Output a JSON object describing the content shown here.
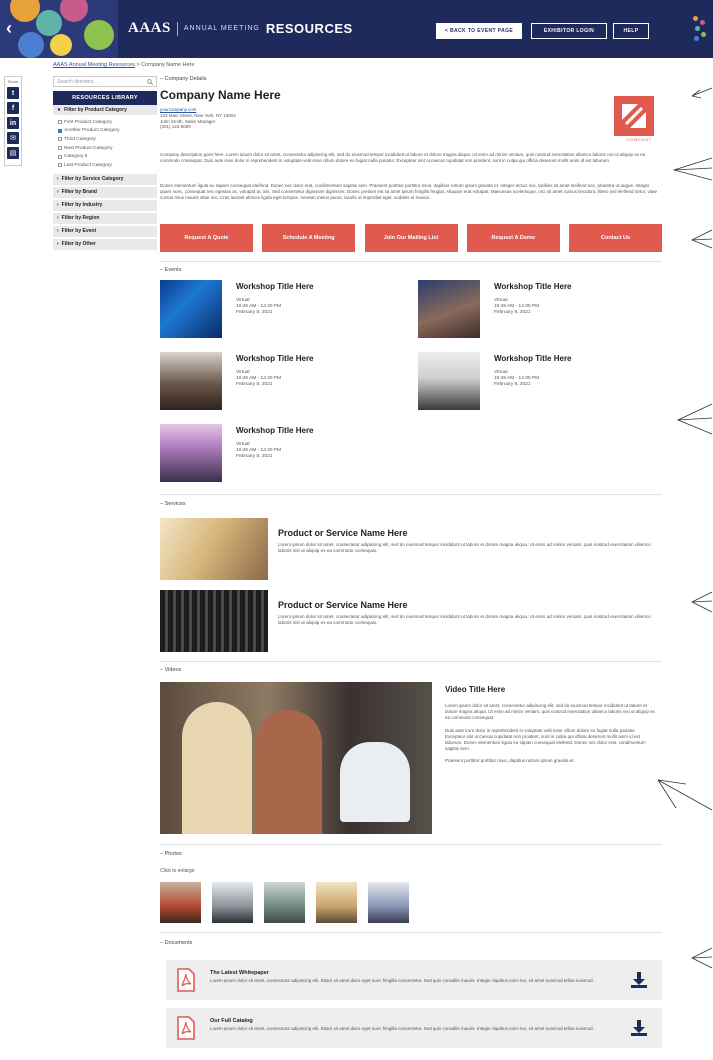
{
  "header": {
    "brand": "AAAS",
    "subtitle": "ANNUAL MEETING",
    "title": "RESOURCES",
    "buttons": {
      "back": "< BACK TO EVENT PAGE",
      "exhibitor": "EXHIBITOR LOGIN",
      "help": "HELP"
    }
  },
  "breadcrumb": {
    "link": "AAAS Annual Meeting Resources",
    "separator": " > ",
    "current": "Company Name Here"
  },
  "share": {
    "label": "Share"
  },
  "sidebar": {
    "search_placeholder": "Search directory...",
    "library_title": "RESOURCES LIBRARY",
    "open_filter": "Filter by Product Category",
    "categories": [
      {
        "label": "First Product Category",
        "checked": false
      },
      {
        "label": "Another Product Category",
        "checked": true
      },
      {
        "label": "Third Category",
        "checked": false
      },
      {
        "label": "Next Product Category",
        "checked": false
      },
      {
        "label": "Category 5",
        "checked": false
      },
      {
        "label": "Last Product Category",
        "checked": false
      }
    ],
    "filters": [
      "Filter by Service Category",
      "Filter by Brand",
      "Filter by Industry",
      "Filter by Region",
      "Filter by Event",
      "Filter by Other"
    ]
  },
  "company": {
    "section": "Company Details",
    "name": "Company Name Here",
    "website": "yourcompany.com",
    "address": "123 Main Street, New York, NY 10004",
    "contact_person": "John Smith, Sales Manager",
    "phone": "(301) 123-5000",
    "logo_text": "COMPANY",
    "desc1": "Company description goes here. Lorem ipsum dolor sit amet, consectetur adipiscing elit, sed do eiusmod tempor incididunt ut labore et dolore magna aliqua. Ut enim ad minim veniam, quis nostrud exercitation ullamco laboris nisi ut aliquip ex ea commodo consequat. Duis aute irure dolor in reprehenderit in voluptate velit esse cillum dolore eu fugiat nulla pariatur. Excepteur sint occaecat cupidatat non proident, sunt in culpa qui officia deserunt mollit anim id est laborum.",
    "desc2": "Donec elementum ligula eu sapien consequat eleifend. Donec nec dolor erat, condimentum sagittis sem. Praesent porttitor porttitor risus, dapibus rutrum ipsum gravida et. Integer lectus nisi, facilisis sit amet eleifend nec, pharetra ut augue. Integer quam nunc, consequat nec egestas ac, volutpat ac nisi. Sed consectetur dignissim dignissim. Donec pretium est sit amet ipsum fringilla feugiat. Aliquam erat volutpat. Maecenas scelerisque, orci sit amet cursus tincidunt, libero nisl eleifend tortor, vitae cursus risus mauris vitae nisi. Cras laoreet ultrices ligula eget tempus. Aenean metus purus, iaculis ut imperdiet eget, sodales et massa."
  },
  "cta": [
    "Request A Quote",
    "Schedule A Meeting",
    "Join Our Mailing List",
    "Request A Demo",
    "Contact Us"
  ],
  "events": {
    "section": "Events",
    "items": [
      {
        "title": "Workshop Title Here",
        "type": "Virtual",
        "time": "10:45 AM - 12:30 PM",
        "date": "February 8, 2021"
      },
      {
        "title": "Workshop Title Here",
        "type": "Virtual",
        "time": "10:45 AM - 12:30 PM",
        "date": "February 8, 2021"
      },
      {
        "title": "Workshop Title Here",
        "type": "Virtual",
        "time": "10:45 AM - 12:30 PM",
        "date": "February 8, 2021"
      },
      {
        "title": "Workshop Title Here",
        "type": "Virtual",
        "time": "10:45 AM - 12:30 PM",
        "date": "February 8, 2021"
      },
      {
        "title": "Workshop Title Here",
        "type": "Virtual",
        "time": "10:45 AM - 12:30 PM",
        "date": "February 8, 2021"
      }
    ]
  },
  "services": {
    "section": "Services",
    "items": [
      {
        "title": "Product or Service Name Here",
        "desc": "Lorem ipsum dolor sit amet, consectetur adipiscing elit, sed do eiusmod tempor incididunt ut labore et dolore magna aliqua. Ut enim ad minim veniam, quis nostrud exercitation ullamco laboris nisi ut aliquip ex ea commodo consequat."
      },
      {
        "title": "Product or Service Name Here",
        "desc": "Lorem ipsum dolor sit amet, consectetur adipiscing elit, sed do eiusmod tempor incididunt ut labore et dolore magna aliqua. Ut enim ad minim veniam, quis nostrud exercitation ullamco laboris nisi ut aliquip ex ea commodo consequat."
      }
    ]
  },
  "videos": {
    "section": "Videos",
    "title": "Video Title Here",
    "p1": "Lorem ipsum dolor sit amet, consectetur adipiscing elit, sed do eiusmod tempor incididunt ut labore et dolore magna aliqua. Ut enim ad minim veniam, quis nostrud exercitation ullamco laboris nisi ut aliquip ex ea commodo consequat.",
    "p2": "Duis aute irure dolor in reprehenderit in voluptate velit esse cillum dolore eu fugiat nulla pariatur. Excepteur sint occaecat cupidatat non proident, sunt in culpa qui officia deserunt mollit anim id est laborum. Donec elementum ligula eu sapien consequat eleifend. Donec nec dolor erat, condimentum sagittis sem.",
    "p3": "Praesent porttitor porttitor risus, dapibus rutrum ipsum gravida et."
  },
  "photos": {
    "section": "Photos",
    "hint": "Click to enlarge"
  },
  "documents": {
    "section": "Documents",
    "items": [
      {
        "title": "The Latest Whitepaper",
        "desc": "Lorem ipsum dolor sit amet, consectetur adipiscing elit. Etiam sit amet diam eget nunc fringilla consectetur. Sed quis convallis mauris. Integer dapibus enim leo, sit amet euismod tellus euismod."
      },
      {
        "title": "Our Full Catalog",
        "desc": "Lorem ipsum dolor sit amet, consectetur adipiscing elit. Etiam sit amet diam eget nunc fringilla consectetur. Sed quis convallis mauris. Integer dapibus enim leo, sit amet euismod tellus euismod."
      }
    ]
  },
  "colors": {
    "navy": "#1f2a5c",
    "accent": "#e05a4e",
    "link": "#2a56a8",
    "panel": "#e9e9ec"
  },
  "icons": [
    "twitter-icon",
    "facebook-icon",
    "linkedin-icon",
    "email-icon",
    "print-icon",
    "search-icon",
    "pdf-icon",
    "download-icon"
  ]
}
